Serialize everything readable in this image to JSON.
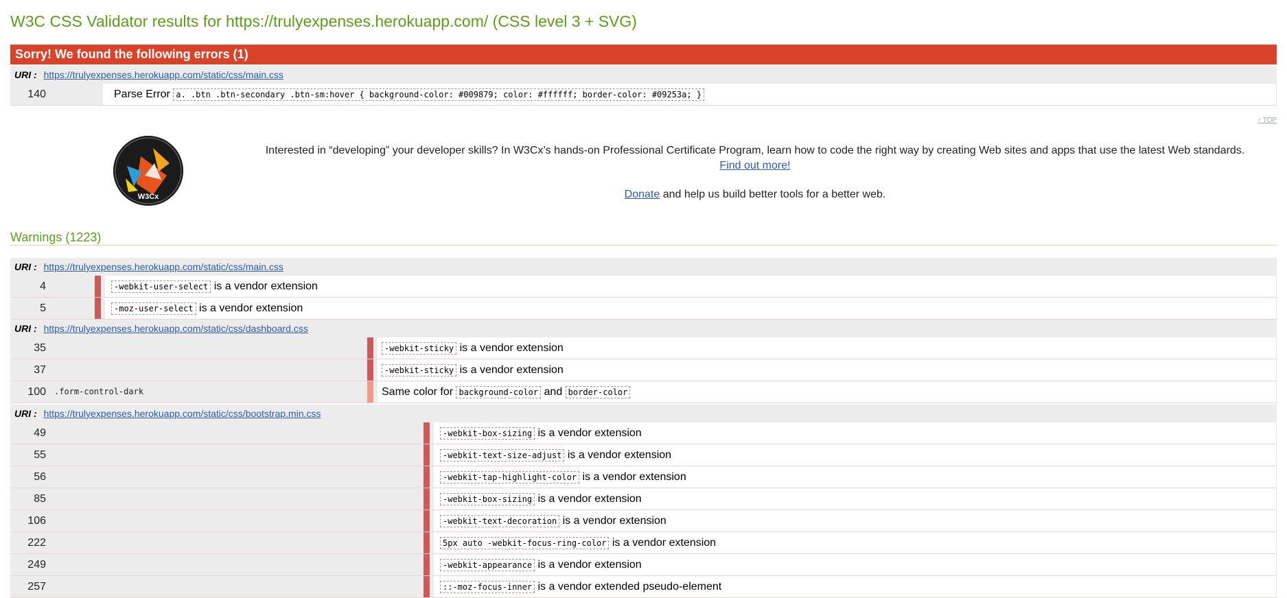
{
  "title": "W3C CSS Validator results for https://trulyexpenses.herokuapp.com/ (CSS level 3 + SVG)",
  "errors": {
    "heading": "Sorry! We found the following errors (1)",
    "uri_label": "URI :",
    "uri": "https://trulyexpenses.herokuapp.com/static/css/main.css",
    "items": [
      {
        "line": "140",
        "type": "Parse Error",
        "code": "a. .btn .btn-secondary .btn-sm:hover { background-color: #009879; color: #ffffff; border-color: #09253a; }"
      }
    ]
  },
  "top_link": "↑ TOP",
  "promo": {
    "logo_text": "W3Cx",
    "text": "Interested in “developing” your developer skills? In W3Cx’s hands-on Professional Certificate Program, learn how to code the right way by creating Web sites and apps that use the latest Web standards.",
    "find_out": "Find out more!",
    "donate": "Donate",
    "donate_rest": " and help us build better tools for a better web."
  },
  "warnings": {
    "heading": "Warnings (1223)",
    "uri_label": "URI :",
    "groups": [
      {
        "uri": "https://trulyexpenses.herokuapp.com/static/css/main.css",
        "items": [
          {
            "line": "4",
            "context": "",
            "code": "-webkit-user-select",
            "text": " is a vendor extension"
          },
          {
            "line": "5",
            "context": "",
            "code": "-moz-user-select",
            "text": " is a vendor extension"
          }
        ]
      },
      {
        "uri": "https://trulyexpenses.herokuapp.com/static/css/dashboard.css",
        "items": [
          {
            "line": "35",
            "context": "",
            "code": "-webkit-sticky",
            "text": " is a vendor extension"
          },
          {
            "line": "37",
            "context": "",
            "code": "-webkit-sticky",
            "text": " is a vendor extension"
          },
          {
            "line": "100",
            "context": ".form-control-dark",
            "pre": "Same color for ",
            "code": "background-color",
            "mid": " and ",
            "code2": "border-color"
          }
        ]
      },
      {
        "uri": "https://trulyexpenses.herokuapp.com/static/css/bootstrap.min.css",
        "items": [
          {
            "line": "49",
            "context": "",
            "code": "-webkit-box-sizing",
            "text": " is a vendor extension"
          },
          {
            "line": "55",
            "context": "",
            "code": "-webkit-text-size-adjust",
            "text": " is a vendor extension"
          },
          {
            "line": "56",
            "context": "",
            "code": "-webkit-tap-highlight-color",
            "text": " is a vendor extension"
          },
          {
            "line": "85",
            "context": "",
            "code": "-webkit-box-sizing",
            "text": " is a vendor extension"
          },
          {
            "line": "106",
            "context": "",
            "code": "-webkit-text-decoration",
            "text": " is a vendor extension"
          },
          {
            "line": "222",
            "context": "",
            "code": "5px auto -webkit-focus-ring-color",
            "text": " is a vendor extension"
          },
          {
            "line": "249",
            "context": "",
            "code": "-webkit-appearance",
            "text": " is a vendor extension"
          },
          {
            "line": "257",
            "context": "",
            "code": "::-moz-focus-inner",
            "text": " is a vendor extended pseudo-element"
          }
        ]
      }
    ]
  }
}
